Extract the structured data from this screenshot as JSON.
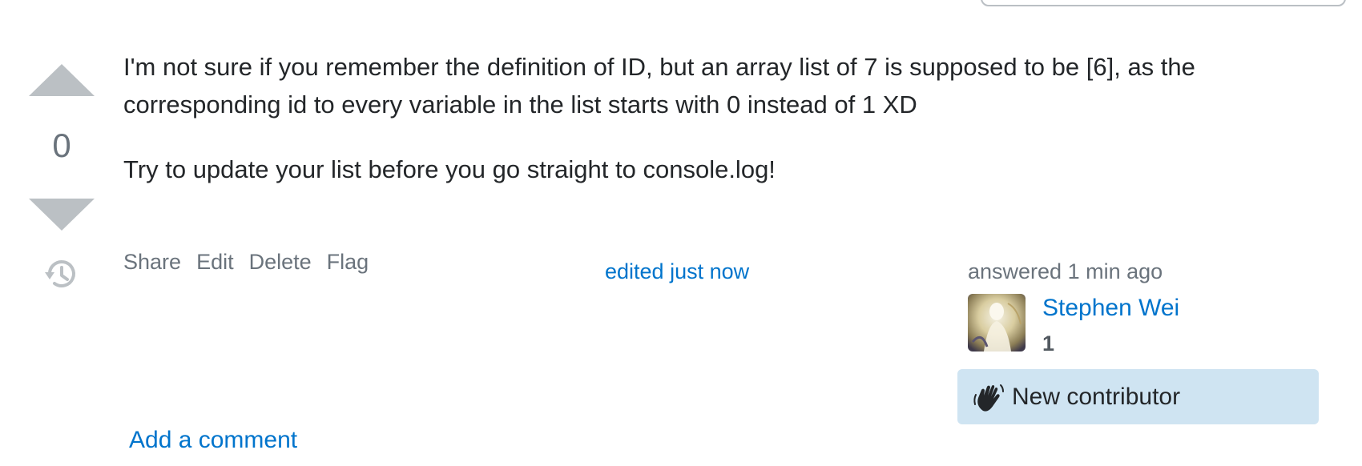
{
  "vote": {
    "count": "0"
  },
  "post": {
    "paragraphs": [
      "I'm not sure if you remember the definition of ID, but an array list of 7 is supposed to be [6], as the corresponding id to every variable in the list starts with 0 instead of 1 XD",
      "Try to update your list before you go straight to console.log!"
    ]
  },
  "post_menu": {
    "share": "Share",
    "edit": "Edit",
    "delete": "Delete",
    "flag": "Flag"
  },
  "edit_info": {
    "label": "edited just now"
  },
  "answer_info": {
    "time": "answered 1 min ago",
    "user_name": "Stephen Wei",
    "reputation": "1",
    "badge_label": "New contributor"
  },
  "comments": {
    "add_label": "Add a comment"
  },
  "icons": {
    "upvote": "upvote-arrow-icon",
    "downvote": "downvote-arrow-icon",
    "history": "history-icon",
    "new_contributor": "waving-hand-icon"
  },
  "colors": {
    "vote_arrow": "#bbc0c4",
    "vote_count": "#6a737c",
    "link": "#0074cc",
    "muted_text": "#6a737c",
    "new_contributor_bg": "#cfe4f2"
  }
}
